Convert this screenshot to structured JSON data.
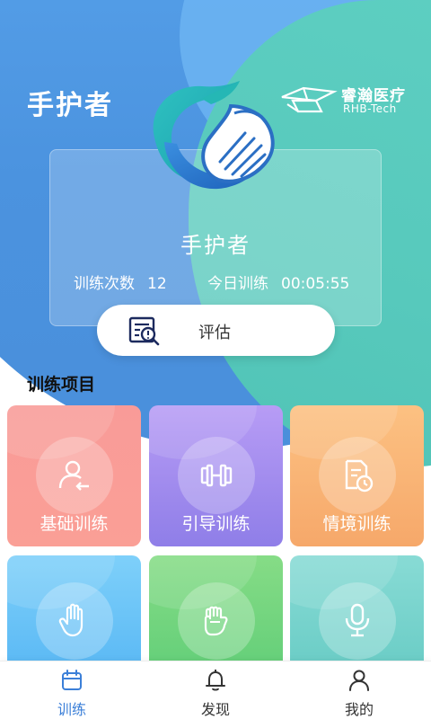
{
  "header": {
    "title": "手护者"
  },
  "brand": {
    "name_cn": "睿瀚医疗",
    "name_en": "RHB-Tech"
  },
  "card": {
    "name": "手护者",
    "train_count_label": "训练次数",
    "train_count_value": "12",
    "today_label": "今日训练",
    "today_value": "00:05:55"
  },
  "assess": {
    "label": "评估",
    "icon": "assessment-icon"
  },
  "section": {
    "title": "训练项目"
  },
  "tiles": [
    {
      "label": "基础训练",
      "icon": "user-add-icon"
    },
    {
      "label": "引导训练",
      "icon": "dumbbell-icon"
    },
    {
      "label": "情境训练",
      "icon": "document-clock-icon"
    },
    {
      "label": "",
      "icon": "open-hand-icon"
    },
    {
      "label": "",
      "icon": "fist-icon"
    },
    {
      "label": "",
      "icon": "microphone-icon"
    }
  ],
  "tabbar": {
    "active": 0,
    "items": [
      {
        "label": "训练",
        "icon": "calendar-icon"
      },
      {
        "label": "发现",
        "icon": "bell-icon"
      },
      {
        "label": "我的",
        "icon": "person-icon"
      }
    ]
  },
  "colors": {
    "bg_blue": "#4b93df",
    "bg_teal": "#57c9bc",
    "active_tab": "#3b7fd8",
    "tile_basic": "#f99b98",
    "tile_guided": "#9f8cee",
    "tile_context": "#f8b274",
    "tile_4": "#62bff6",
    "tile_5": "#6ed47c",
    "tile_6": "#72d0c9"
  }
}
